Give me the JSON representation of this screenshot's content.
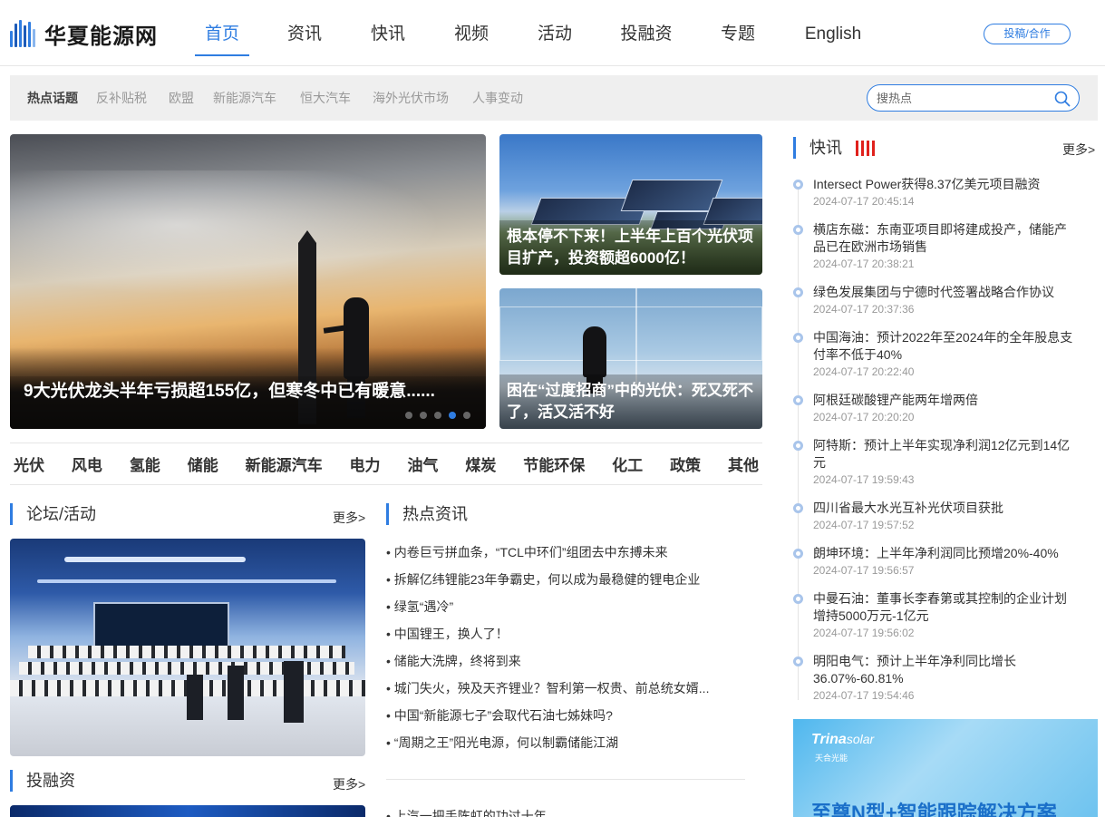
{
  "site": {
    "name": "华夏能源网",
    "submit_label": "投稿/合作"
  },
  "nav": [
    "首页",
    "资讯",
    "快讯",
    "视频",
    "活动",
    "投融资",
    "专题",
    "English"
  ],
  "topics": {
    "label": "热点话题",
    "items": [
      "反补贴税",
      "欧盟",
      "新能源汽车",
      "恒大汽车",
      "海外光伏市场",
      "人事变动"
    ]
  },
  "search": {
    "placeholder": "搜热点"
  },
  "carousel": {
    "title": "9大光伏龙头半年亏损超155亿，但寒冬中已有暖意......",
    "slide_count": 5,
    "active_index": 3
  },
  "side_cards": [
    {
      "title": "根本停不下来！上半年上百个光伏项目扩产，投资额超6000亿！"
    },
    {
      "title": "困在“过度招商”中的光伏：死又死不了，活又活不好"
    }
  ],
  "categories": [
    "光伏",
    "风电",
    "氢能",
    "储能",
    "新能源汽车",
    "电力",
    "油气",
    "煤炭",
    "节能环保",
    "化工",
    "政策",
    "其他"
  ],
  "forum": {
    "title": "论坛/活动",
    "more": "更多>"
  },
  "hot_news": {
    "title": "热点资讯",
    "items": [
      "内卷巨亏拼血条，“TCL中环们”组团去中东搏未来",
      "拆解亿纬锂能23年争霸史，何以成为最稳健的锂电企业",
      "绿氢“遇冷”",
      "中国锂王，换人了！",
      "储能大洗牌，终将到来",
      "城门失火，殃及天齐锂业？智利第一权贵、前总统女婿...",
      "中国“新能源七子”会取代石油七姊妹吗?",
      "“周期之王”阳光电源，何以制霸储能江湖"
    ],
    "next_item": "上汽一把手陈虹的功过十年"
  },
  "invest": {
    "title": "投融资",
    "more": "更多>"
  },
  "flash": {
    "title": "快讯",
    "more": "更多>",
    "items": [
      {
        "title": "Intersect Power获得8.37亿美元项目融资",
        "time": "2024-07-17 20:45:14"
      },
      {
        "title": "横店东磁：东南亚项目即将建成投产，储能产品已在欧洲市场销售",
        "time": "2024-07-17 20:38:21"
      },
      {
        "title": "绿色发展集团与宁德时代签署战略合作协议",
        "time": "2024-07-17 20:37:36"
      },
      {
        "title": "中国海油：预计2022年至2024年的全年股息支付率不低于40%",
        "time": "2024-07-17 20:22:40"
      },
      {
        "title": "阿根廷碳酸锂产能两年增两倍",
        "time": "2024-07-17 20:20:20"
      },
      {
        "title": "阿特斯：预计上半年实现净利润12亿元到14亿元",
        "time": "2024-07-17 19:59:43"
      },
      {
        "title": "四川省最大水光互补光伏项目获批",
        "time": "2024-07-17 19:57:52"
      },
      {
        "title": "朗坤环境：上半年净利润同比预增20%-40%",
        "time": "2024-07-17 19:56:57"
      },
      {
        "title": "中曼石油：董事长李春第或其控制的企业计划增持5000万元-1亿元",
        "time": "2024-07-17 19:56:02"
      },
      {
        "title": "明阳电气：预计上半年净利同比增长36.07%-60.81%",
        "time": "2024-07-17 19:54:46"
      }
    ]
  },
  "ad": {
    "brand": "Trina",
    "brand_suffix": "solar",
    "brand_cn": "天合光能",
    "slogan": "至尊N型+智能跟踪解决方案"
  },
  "colors": {
    "accent": "#2f7de1",
    "flash_icon": "#e0211c"
  }
}
